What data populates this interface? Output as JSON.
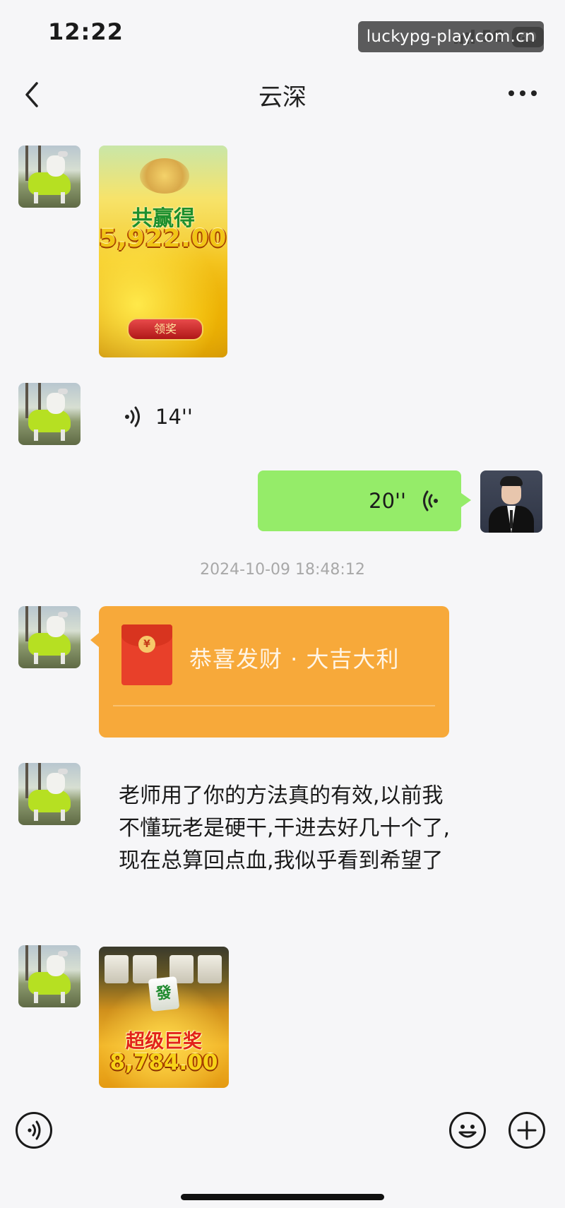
{
  "status_bar": {
    "time": "12:22",
    "network": "5G",
    "battery": "80",
    "watermark": "luckypg-play.com.cn"
  },
  "header": {
    "title": "云深"
  },
  "messages": {
    "win_image_1": {
      "title": "共赢得",
      "amount": "5,922.00",
      "button_label": "领奖"
    },
    "voice_received": {
      "duration": "14''"
    },
    "voice_sent": {
      "duration": "20''"
    },
    "timestamp": "2024-10-09 18:48:12",
    "red_packet": {
      "icon_symbol": "¥",
      "greeting": "恭喜发财 · 大吉大利"
    },
    "text_message": "老师用了你的方法真的有效,以前我不懂玩老是硬干,干进去好几十个了,现在总算回点血,我似乎看到希望了",
    "win_image_2": {
      "tile_symbol": "發",
      "title": "超级巨奖",
      "amount": "8,784.00"
    }
  },
  "colors": {
    "sent_bubble": "#95ec69",
    "red_packet_bg": "#f7a93a",
    "red_packet_icon": "#e8402a",
    "background": "#f6f6f8"
  },
  "icons": [
    "back-chevron-icon",
    "more-icon",
    "voice-wave-icon",
    "emoji-icon",
    "plus-icon",
    "voice-mode-icon"
  ]
}
